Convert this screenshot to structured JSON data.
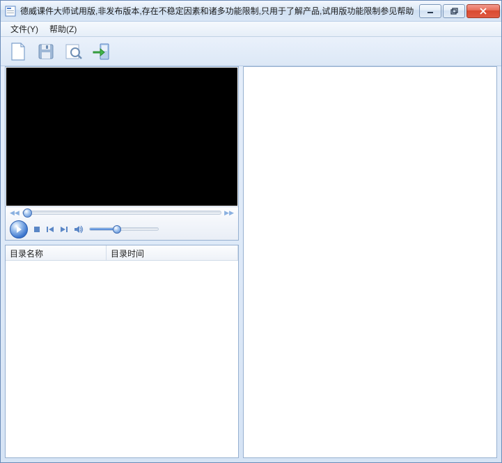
{
  "window": {
    "title": "德威课件大师试用版,非发布版本,存在不稳定因素和诸多功能限制,只用于了解产品,试用版功能限制参见帮助"
  },
  "menu": {
    "file": "文件(Y)",
    "help": "帮助(Z)"
  },
  "toolbar": {
    "new_tip": "新建",
    "save_tip": "保存",
    "preview_tip": "预览",
    "export_tip": "导出"
  },
  "list": {
    "col_name": "目录名称",
    "col_time": "目录时间",
    "rows": []
  },
  "player": {
    "position": 0,
    "volume": 40
  }
}
